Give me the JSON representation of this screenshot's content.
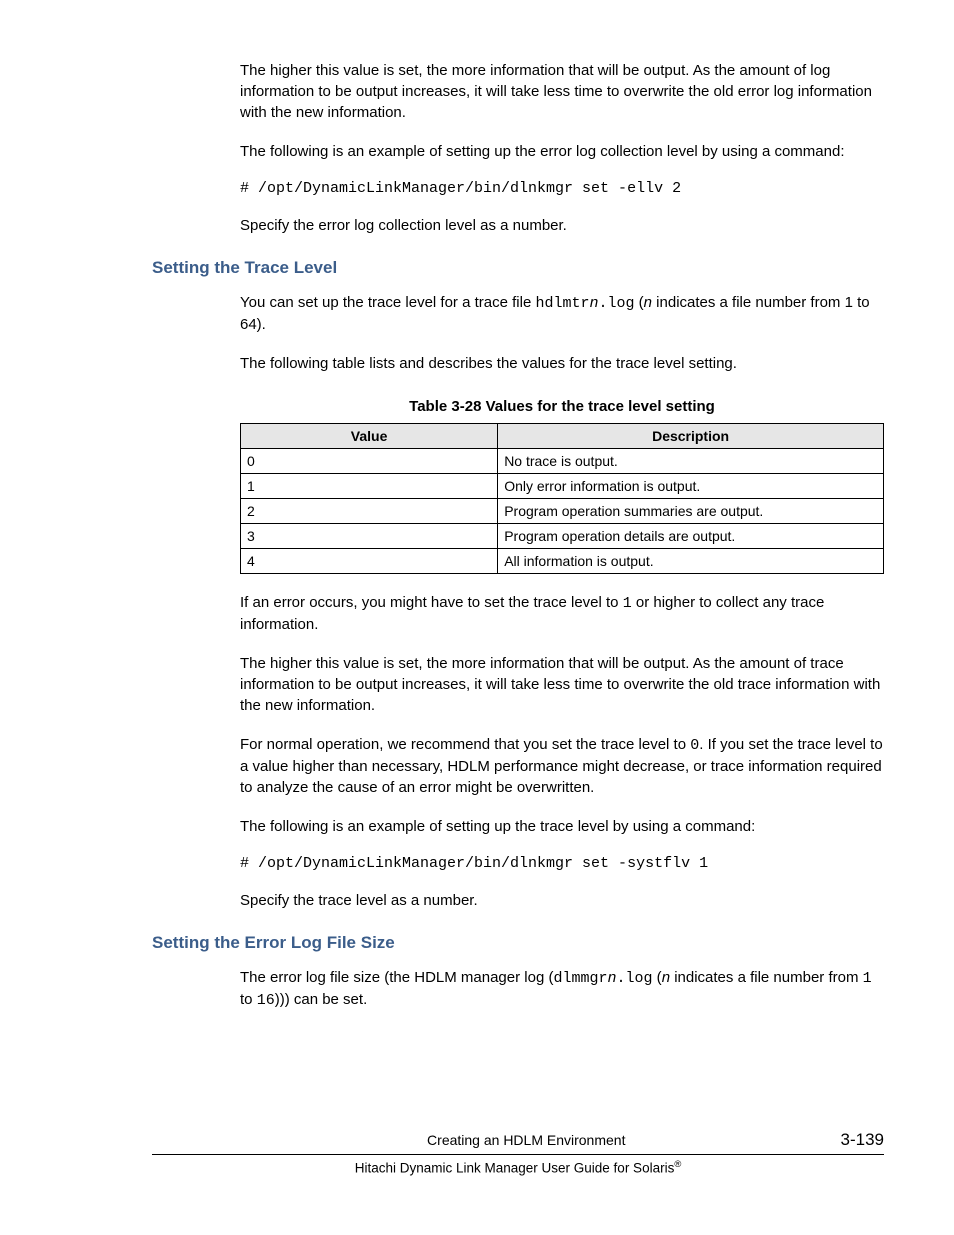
{
  "intro": {
    "p1": "The higher this value is set, the more information that will be output. As the amount of log information to be output increases, it will take less time to overwrite the old error log information with the new information.",
    "p2": "The following is an example of setting up the error log collection level by using a command:",
    "code1": "# /opt/DynamicLinkManager/bin/dlnkmgr set -ellv 2",
    "p3": "Specify the error log collection level as a number."
  },
  "section1": {
    "heading": "Setting the Trace Level",
    "p1a": "You can set up the trace level for a trace file ",
    "p1_code": "hdlmtr",
    "p1_n": "n",
    "p1_code2": ".log",
    "p1b": " (",
    "p1_n2": "n",
    "p1c": " indicates a file number from 1 to 64).",
    "p2": "The following table lists and describes the values for the trace level setting.",
    "table_caption": "Table 3-28 Values for the trace level setting",
    "table": {
      "header": {
        "col1": "Value",
        "col2": "Description"
      },
      "rows": [
        {
          "value": "0",
          "desc": "No trace is output."
        },
        {
          "value": "1",
          "desc": "Only error information is output."
        },
        {
          "value": "2",
          "desc": "Program operation summaries are output."
        },
        {
          "value": "3",
          "desc": "Program operation details are output."
        },
        {
          "value": "4",
          "desc": "All information is output."
        }
      ]
    },
    "p3a": "If an error occurs, you might have to set the trace level to ",
    "p3_code": "1",
    "p3b": " or higher to collect any trace information.",
    "p4": "The higher this value is set, the more information that will be output. As the amount of trace information to be output increases, it will take less time to overwrite the old trace information with the new information.",
    "p5a": "For normal operation, we recommend that you set the trace level to ",
    "p5_code": "0",
    "p5b": ". If you set the trace level to a value higher than necessary, HDLM performance might decrease, or trace information required to analyze the cause of an error might be overwritten.",
    "p6": "The following is an example of setting up the trace level by using a command:",
    "code2": "# /opt/DynamicLinkManager/bin/dlnkmgr set -systflv 1",
    "p7": "Specify the trace level as a number."
  },
  "section2": {
    "heading": "Setting the Error Log File Size",
    "p1a": "The error log file size (the HDLM manager log (",
    "p1_code1": "dlmmgr",
    "p1_n": "n",
    "p1_code2": ".log",
    "p1b": " (",
    "p1_n2": "n",
    "p1c": " indicates a file number from ",
    "p1_code3": "1",
    "p1d": " to ",
    "p1_code4": "16",
    "p1e": "))) can be set."
  },
  "footer": {
    "chapter": "Creating an HDLM Environment",
    "pagenum": "3-139",
    "booktitle": "Hitachi Dynamic Link Manager User Guide for Solaris",
    "reg": "®"
  },
  "chart_data": {
    "type": "table",
    "title": "Table 3-28 Values for the trace level setting",
    "columns": [
      "Value",
      "Description"
    ],
    "rows": [
      [
        "0",
        "No trace is output."
      ],
      [
        "1",
        "Only error information is output."
      ],
      [
        "2",
        "Program operation summaries are output."
      ],
      [
        "3",
        "Program operation details are output."
      ],
      [
        "4",
        "All information is output."
      ]
    ]
  }
}
